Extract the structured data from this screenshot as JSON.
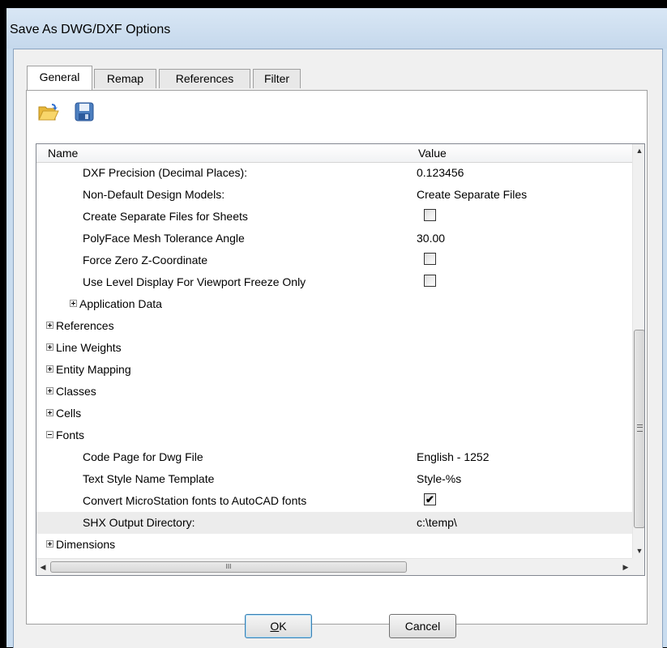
{
  "window": {
    "title": "Save As DWG/DXF Options"
  },
  "tabs": [
    {
      "label": "General",
      "active": true
    },
    {
      "label": "Remap",
      "active": false
    },
    {
      "label": "References",
      "active": false
    },
    {
      "label": "Filter",
      "active": false
    }
  ],
  "toolbar": {
    "icons": [
      "open-folder-icon",
      "save-icon"
    ]
  },
  "grid": {
    "columns": [
      "Name",
      "Value"
    ],
    "rows": [
      {
        "name": "DXF Precision (Decimal Places):",
        "value": "0.123456"
      },
      {
        "name": "Non-Default Design Models:",
        "value": "Create Separate Files"
      },
      {
        "name": "Create Separate Files for Sheets",
        "checkbox": false
      },
      {
        "name": "PolyFace Mesh Tolerance Angle",
        "value": "30.00"
      },
      {
        "name": "Force Zero Z-Coordinate",
        "checkbox": false
      },
      {
        "name": "Use Level Display For Viewport Freeze Only",
        "checkbox": false
      },
      {
        "name": "Application Data",
        "expander": "plus"
      },
      {
        "name": "References",
        "expander": "plus"
      },
      {
        "name": "Line Weights",
        "expander": "plus"
      },
      {
        "name": "Entity Mapping",
        "expander": "plus"
      },
      {
        "name": "Classes",
        "expander": "plus"
      },
      {
        "name": "Cells",
        "expander": "plus"
      },
      {
        "name": "Fonts",
        "expander": "minus"
      },
      {
        "name": "Code Page for Dwg File",
        "value": "English - 1252"
      },
      {
        "name": "Text Style Name Template",
        "value": "Style-%s"
      },
      {
        "name": "Convert MicroStation fonts to AutoCAD fonts",
        "checkbox": true
      },
      {
        "name": "SHX Output Directory:",
        "value": "c:\\temp\\",
        "selected": true
      },
      {
        "name": "Dimensions",
        "expander": "plus"
      }
    ],
    "hscroll_thumb_glyph": "III"
  },
  "buttons": {
    "ok": {
      "mnemonic": "O",
      "rest": "K"
    },
    "cancel": "Cancel"
  }
}
